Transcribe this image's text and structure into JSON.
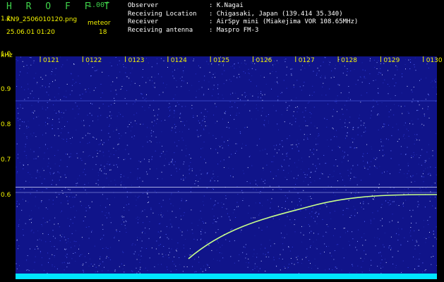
{
  "header": {
    "app_title": "H R O F F T",
    "version": "1.00f",
    "filename": "KN9_2506010120.png",
    "mode": "meteor",
    "timestamp": "25.06.01 01:20",
    "meteor_count": "18"
  },
  "info": [
    {
      "key": "Observer",
      "value": ": K.Nagai"
    },
    {
      "key": "Receiving Location",
      "value": ": Chigasaki, Japan (139.414 35.340)"
    },
    {
      "key": "Receiver",
      "value": ": AirSpy mini (Miakejima VOR 108.65MHz)"
    },
    {
      "key": "Receiving antenna",
      "value": ": Maspro FM-3"
    }
  ],
  "axis": {
    "y_unit": "kHz",
    "y_ticks": [
      "1.1",
      "1.0",
      "0.9",
      "0.8",
      "0.7",
      "0.6"
    ],
    "x_ticks": [
      "0121",
      "0122",
      "0123",
      "0124",
      "0125",
      "0126",
      "0127",
      "0128",
      "0129",
      "0130"
    ]
  },
  "colors": {
    "background": "#000000",
    "title_green": "#3fd24a",
    "label_yellow": "#f2f200",
    "spectrogram_base": "#10148a",
    "carrier_line": "#ff6a6a",
    "meteor_trail": "#c8ff8a",
    "bottom_band": "#00e5ff"
  }
}
